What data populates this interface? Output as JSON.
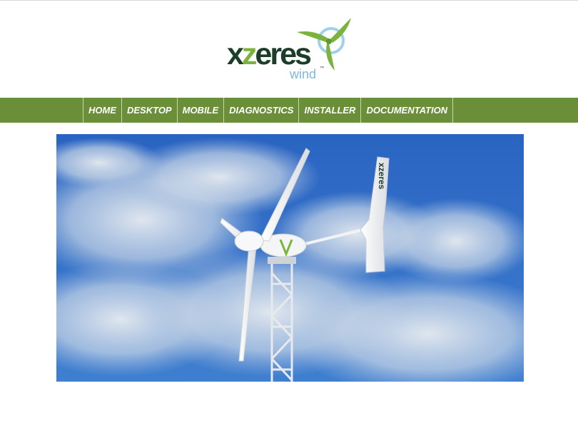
{
  "brand": {
    "name_prefix": "x",
    "name_accent": "z",
    "name_suffix": "eres",
    "sub": "wind",
    "tm": "™",
    "colors": {
      "dark_green": "#1c3d29",
      "light_green": "#7bb33c",
      "sky_blue": "#7fb9d8"
    }
  },
  "nav": {
    "items": [
      {
        "label": "HOME"
      },
      {
        "label": "DESKTOP"
      },
      {
        "label": "MOBILE"
      },
      {
        "label": "DIAGNOSTICS"
      },
      {
        "label": "INSTALLER"
      },
      {
        "label": "DOCUMENTATION"
      }
    ],
    "bar_color": "#6b8f38"
  },
  "hero": {
    "tail_text": "xzeres",
    "sky_color": "#2f6cc4"
  }
}
